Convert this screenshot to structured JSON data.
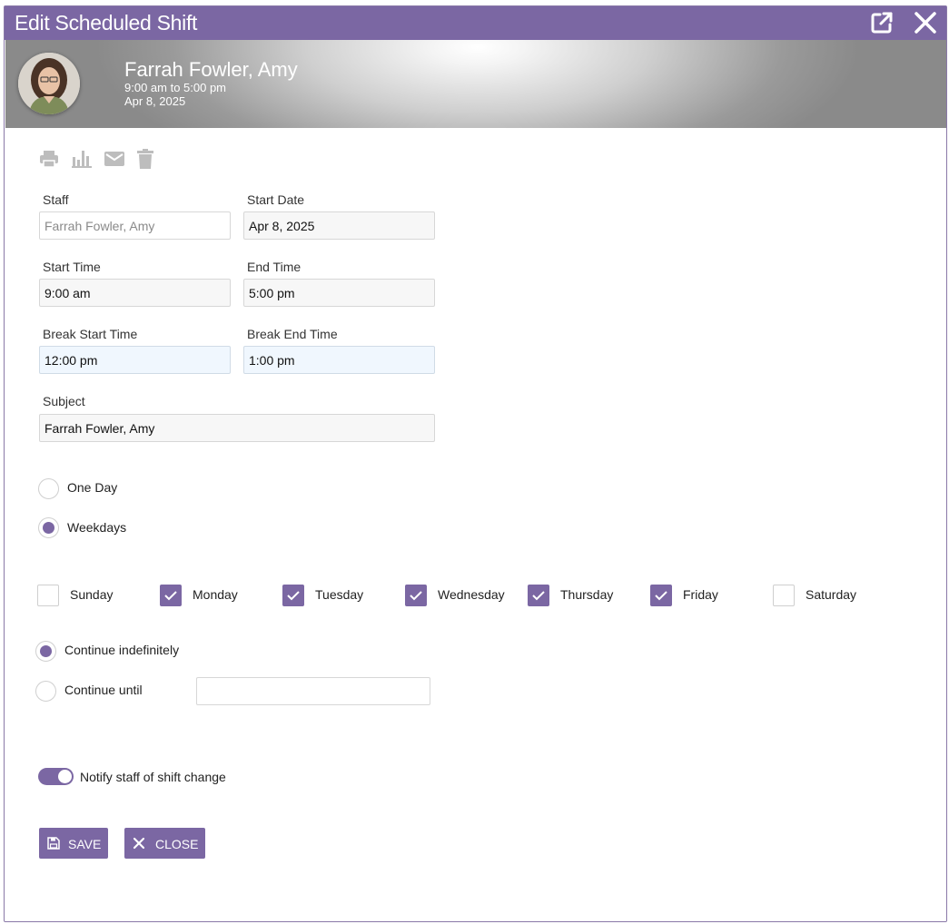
{
  "dialog": {
    "title": "Edit Scheduled Shift",
    "popout_icon": "external-link-icon",
    "close_icon": "close-icon"
  },
  "header": {
    "name": "Farrah Fowler, Amy",
    "time_range": "9:00 am to 5:00 pm",
    "date": "Apr 8, 2025"
  },
  "toolbar": {
    "icons": [
      "print-icon",
      "chart-icon",
      "email-icon",
      "trash-icon"
    ]
  },
  "form": {
    "staff_label": "Staff",
    "staff_value": "Farrah Fowler, Amy",
    "start_date_label": "Start Date",
    "start_date_value": "Apr 8, 2025",
    "start_time_label": "Start Time",
    "start_time_value": "9:00 am",
    "end_time_label": "End Time",
    "end_time_value": "5:00 pm",
    "break_start_label": "Break Start Time",
    "break_start_value": "12:00 pm",
    "break_end_label": "Break End Time",
    "break_end_value": "1:00 pm",
    "subject_label": "Subject",
    "subject_value": "Farrah Fowler, Amy"
  },
  "recurrence": {
    "one_day_label": "One Day",
    "weekdays_label": "Weekdays",
    "selected": "Weekdays"
  },
  "days": [
    {
      "label": "Sunday",
      "checked": false
    },
    {
      "label": "Monday",
      "checked": true
    },
    {
      "label": "Tuesday",
      "checked": true
    },
    {
      "label": "Wednesday",
      "checked": true
    },
    {
      "label": "Thursday",
      "checked": true
    },
    {
      "label": "Friday",
      "checked": true
    },
    {
      "label": "Saturday",
      "checked": false
    }
  ],
  "continue": {
    "indefinitely_label": "Continue indefinitely",
    "until_label": "Continue until",
    "until_value": "",
    "selected": "Continue indefinitely"
  },
  "notify": {
    "label": "Notify staff of shift change",
    "on": true
  },
  "actions": {
    "save_label": "SAVE",
    "close_label": "CLOSE"
  },
  "colors": {
    "accent": "#7b67a3",
    "field_bg": "#f7f7f7",
    "break_field_bg": "#f0f7fe"
  }
}
